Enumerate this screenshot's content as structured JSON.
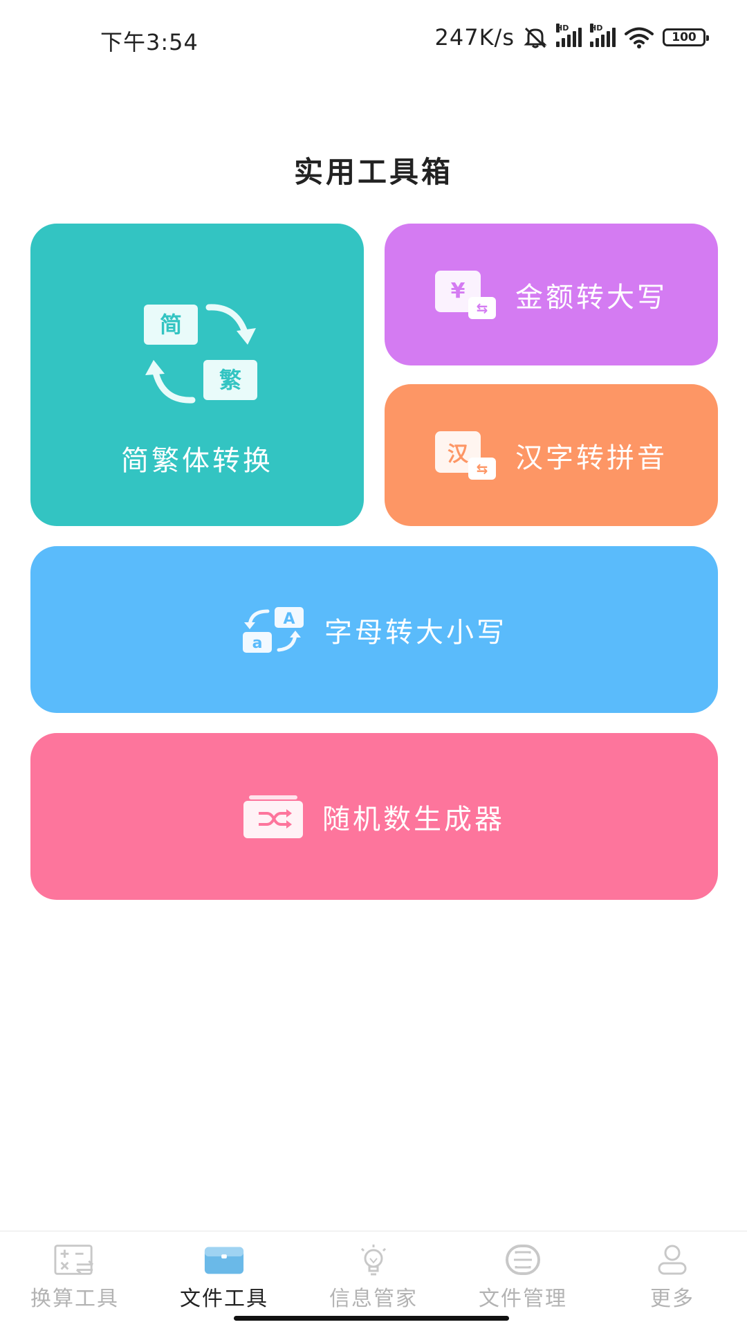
{
  "status_bar": {
    "time": "下午3:54",
    "speed": "247K/s",
    "hd1": "HD",
    "hd2": "HD",
    "battery": "100"
  },
  "page": {
    "title": "实用工具箱"
  },
  "cards": {
    "simp_trad": {
      "label": "简繁体转换",
      "icon_char_simp": "简",
      "icon_char_trad": "繁",
      "color": "#33c4c2"
    },
    "amount_upper": {
      "label": "金额转大写",
      "icon_char": "¥",
      "icon_swap": "⇆",
      "color": "#d47bf2"
    },
    "hanzi_pinyin": {
      "label": "汉字转拼音",
      "icon_char": "汉",
      "icon_swap": "⇆",
      "color": "#fd9665"
    },
    "letter_case": {
      "label": "字母转大小写",
      "icon_upper": "A",
      "icon_lower": "a",
      "color": "#5abbfb"
    },
    "random_number": {
      "label": "随机数生成器",
      "icon_name": "shuffle-icon",
      "color": "#fd759c"
    }
  },
  "bottom_nav": {
    "items": [
      {
        "label": "换算工具",
        "icon": "calculator-icon",
        "active": false
      },
      {
        "label": "文件工具",
        "icon": "toolbox-icon",
        "active": true
      },
      {
        "label": "信息管家",
        "icon": "lightbulb-icon",
        "active": false
      },
      {
        "label": "文件管理",
        "icon": "scan-icon",
        "active": false
      },
      {
        "label": "更多",
        "icon": "user-icon",
        "active": false
      }
    ]
  }
}
